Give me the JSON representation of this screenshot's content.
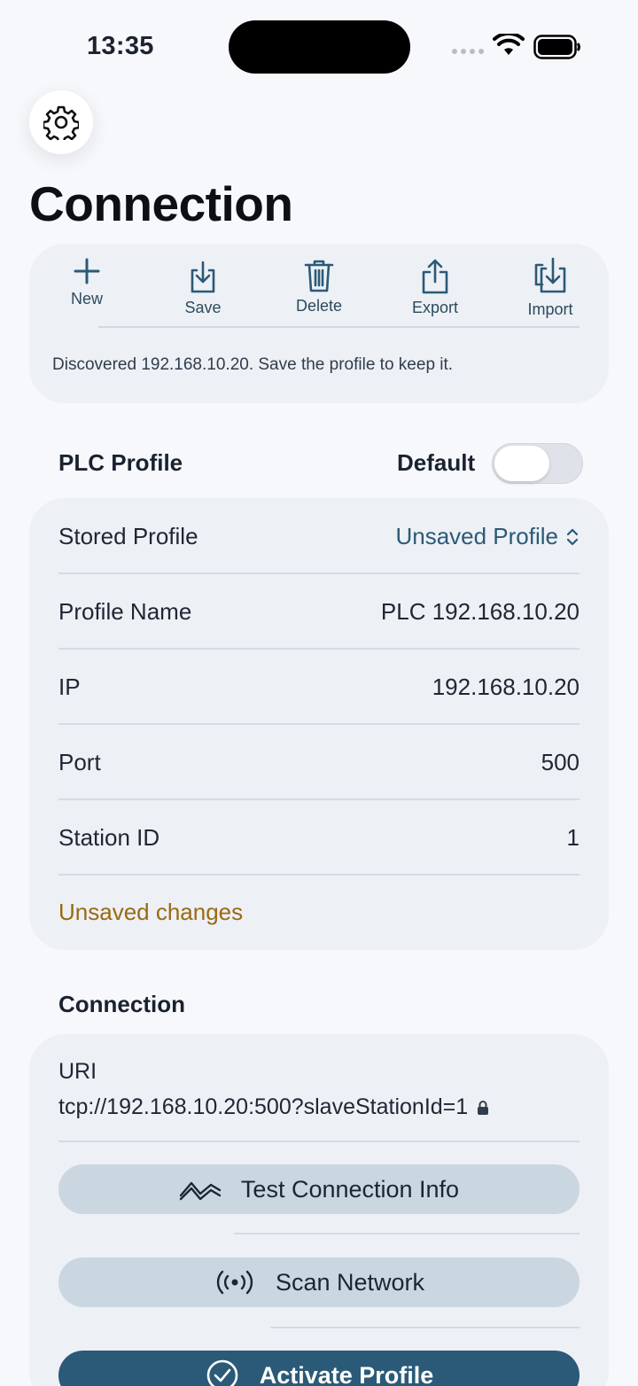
{
  "status_bar": {
    "time": "13:35"
  },
  "header": {
    "title": "Connection"
  },
  "toolbar": {
    "items": [
      {
        "label": "New",
        "icon": "plus-icon"
      },
      {
        "label": "Save",
        "icon": "tray-download-icon"
      },
      {
        "label": "Delete",
        "icon": "trash-icon"
      },
      {
        "label": "Export",
        "icon": "share-icon"
      },
      {
        "label": "Import",
        "icon": "import-icon"
      }
    ],
    "message": "Discovered 192.168.10.20. Save the profile to keep it."
  },
  "plc_profile": {
    "section_title": "PLC Profile",
    "default_label": "Default",
    "default_on": false,
    "rows": [
      {
        "label": "Stored Profile",
        "value": "Unsaved Profile"
      },
      {
        "label": "Profile Name",
        "value": "PLC 192.168.10.20"
      },
      {
        "label": "IP",
        "value": "192.168.10.20"
      },
      {
        "label": "Port",
        "value": "500"
      },
      {
        "label": "Station ID",
        "value": "1"
      }
    ],
    "status": "Unsaved changes"
  },
  "connection": {
    "section_title": "Connection",
    "uri_label": "URI",
    "uri_value": "tcp://192.168.10.20:500?slaveStationId=1",
    "test_button": "Test Connection Info",
    "scan_button": "Scan Network",
    "activate_button": "Activate Profile"
  },
  "colors": {
    "accent": "#2a5a77",
    "warning": "#9a6a12",
    "card": "#edf0f5",
    "background": "#f7f8fb"
  }
}
